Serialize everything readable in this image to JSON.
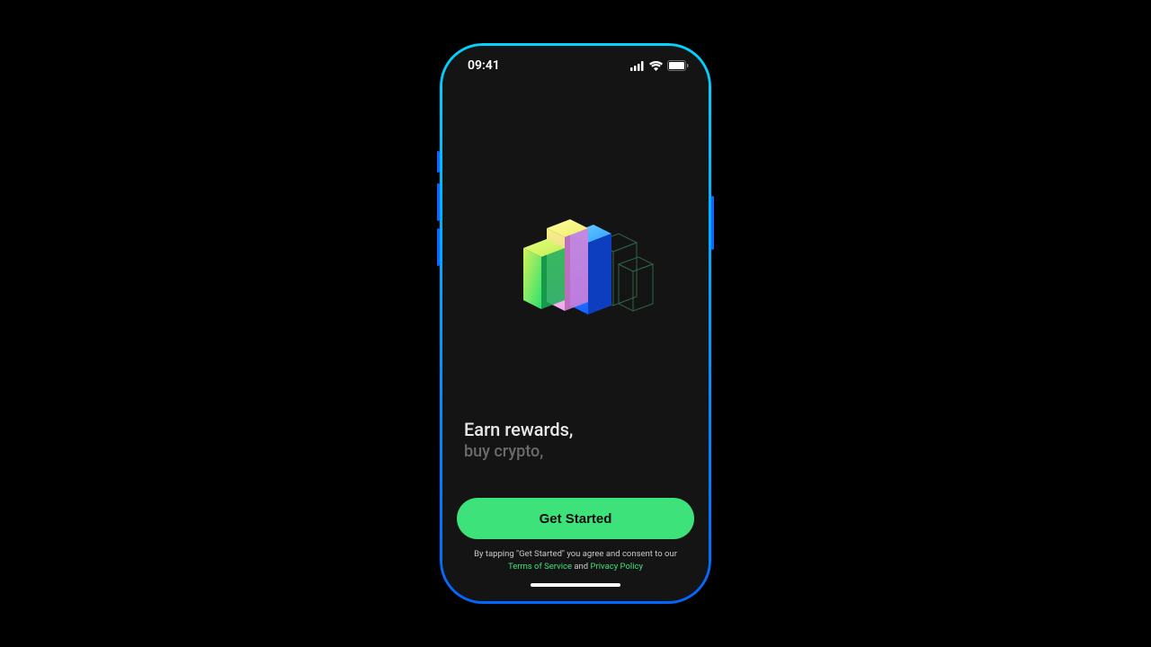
{
  "statusBar": {
    "time": "09:41"
  },
  "tagline": {
    "line1": "Earn rewards,",
    "line2": "buy crypto,"
  },
  "cta": {
    "label": "Get Started"
  },
  "legal": {
    "prefix": "By tapping \"Get Started\" you agree and consent to our",
    "terms": "Terms of Service",
    "and": " and ",
    "privacy": "Privacy Policy"
  }
}
